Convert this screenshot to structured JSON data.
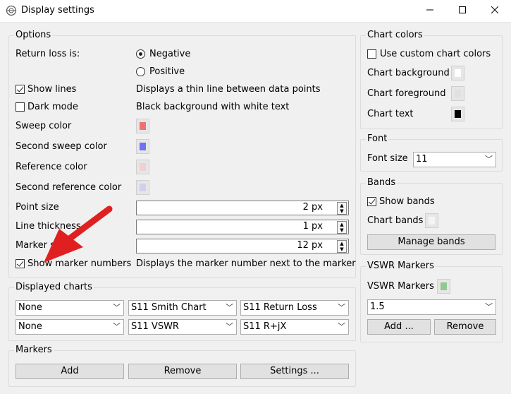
{
  "window": {
    "title": "Display settings"
  },
  "options": {
    "title": "Options",
    "return_loss_label": "Return loss is:",
    "negative": "Negative",
    "positive": "Positive",
    "show_lines": "Show lines",
    "show_lines_desc": "Displays a thin line between data points",
    "dark_mode": "Dark mode",
    "dark_mode_desc": "Black background with white text",
    "sweep_color": "Sweep color",
    "second_sweep_color": "Second sweep color",
    "reference_color": "Reference color",
    "second_reference_color": "Second reference color",
    "point_size": "Point size",
    "point_size_value": "2 px",
    "line_thickness": "Line thickness",
    "line_thickness_value": "1 px",
    "marker_size": "Marker size",
    "marker_size_value": "12 px",
    "show_marker_numbers": "Show marker numbers",
    "show_marker_numbers_desc": "Displays the marker number next to the marker"
  },
  "displayed_charts": {
    "title": "Displayed charts",
    "row1": [
      "None",
      "S11 Smith Chart",
      "S11 Return Loss"
    ],
    "row2": [
      "None",
      "S11 VSWR",
      "S11 R+jX"
    ]
  },
  "markers": {
    "title": "Markers",
    "add": "Add",
    "remove": "Remove",
    "settings": "Settings ..."
  },
  "chart_colors": {
    "title": "Chart colors",
    "use_custom": "Use custom chart colors",
    "background": "Chart background",
    "foreground": "Chart foreground",
    "text": "Chart text"
  },
  "font": {
    "title": "Font",
    "size_label": "Font size",
    "size_value": "11"
  },
  "bands": {
    "title": "Bands",
    "show": "Show bands",
    "chart_bands": "Chart bands",
    "manage": "Manage bands"
  },
  "vswr": {
    "title": "VSWR Markers",
    "label": "VSWR Markers",
    "value": "1.5",
    "add": "Add ...",
    "remove": "Remove"
  },
  "colors": {
    "sweep": "#f07070",
    "second_sweep": "#7070f0",
    "reference": "#f0d0d0",
    "second_reference": "#d0d0f0",
    "chart_background": "#ffffff",
    "chart_foreground": "#e0e0e0",
    "chart_text": "#000000",
    "chart_bands": "#f4f4f4",
    "vswr_marker": "#90c890",
    "annotation_arrow": "#e02020"
  }
}
